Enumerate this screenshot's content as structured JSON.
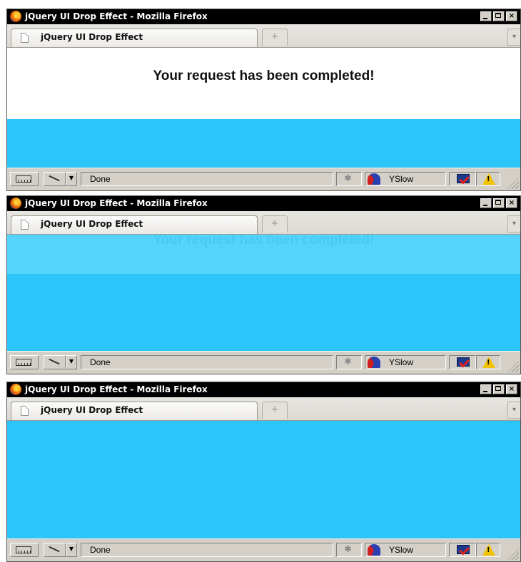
{
  "window_title": "jQuery UI Drop Effect - Mozilla Firefox",
  "tab_label": "jQuery UI Drop Effect",
  "message": "Your request has been completed!",
  "new_tab_glyph": "+",
  "tab_scroll_glyph": "▾",
  "status": {
    "done_label": "Done",
    "yslow_label": "YSlow"
  },
  "icons": {
    "browser": "firefox-icon",
    "page": "page-icon",
    "ruler": "ruler-icon",
    "picker": "color-picker-icon",
    "dropdown": "chevron-down-icon",
    "firebug": "firebug-icon",
    "yslow": "yslow-gauge-icon",
    "validator": "html-validator-icon",
    "warning": "warning-icon",
    "resize": "resize-grip-icon"
  },
  "colors": {
    "content_background": "#2bc5f9",
    "message_box_background": "#ffffff",
    "titlebar_background": "#000000"
  },
  "frames": [
    {
      "label": "frame-1",
      "message_visible": true,
      "message_opacity": 1.0
    },
    {
      "label": "frame-2",
      "message_visible": true,
      "message_opacity": 0.3
    },
    {
      "label": "frame-3",
      "message_visible": false,
      "message_opacity": 0.0
    }
  ]
}
